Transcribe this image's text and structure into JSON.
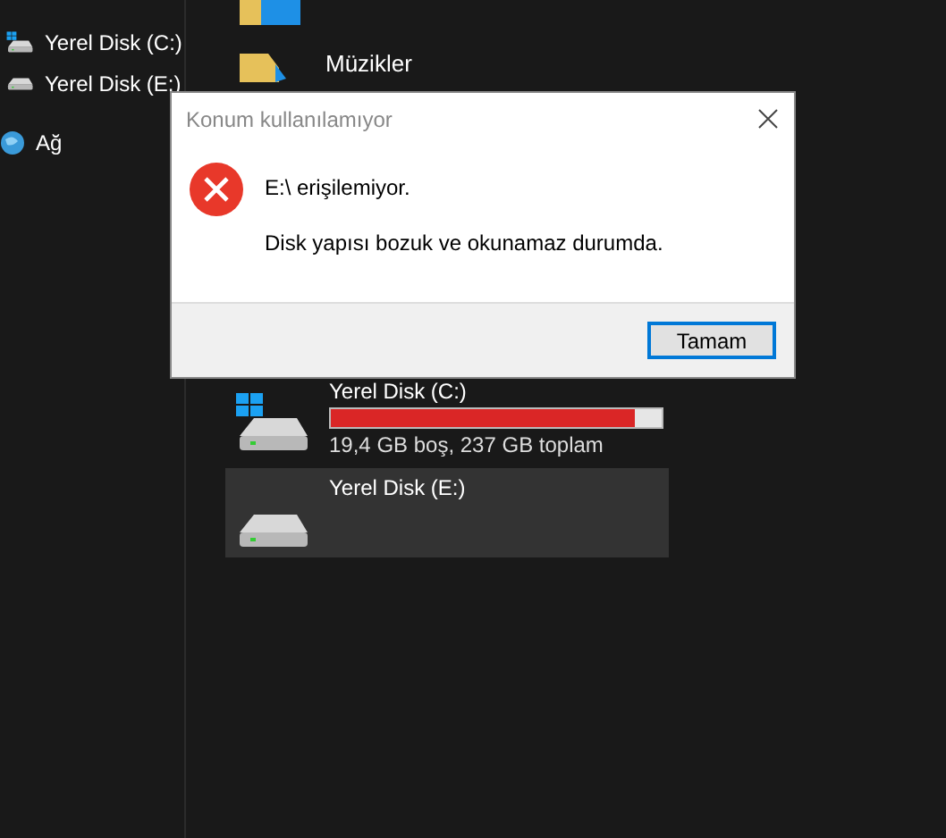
{
  "sidebar": {
    "items": [
      {
        "label": "Yerel Disk (C:)",
        "kind": "drive"
      },
      {
        "label": "Yerel Disk (E:)",
        "kind": "drive"
      },
      {
        "label": "Ağ",
        "kind": "network"
      }
    ]
  },
  "folders": [
    {
      "label": "Müzikler"
    }
  ],
  "drives": [
    {
      "name": "Yerel Disk (C:)",
      "system": true,
      "level": 0.92,
      "info": "19,4 GB boş, 237 GB toplam",
      "selected": false
    },
    {
      "name": "Yerel Disk (E:)",
      "system": false,
      "selected": true
    }
  ],
  "dialog": {
    "title": "Konum kullanılamıyor",
    "heading": "E:\\ erişilemiyor.",
    "message": "Disk yapısı bozuk ve okunamaz durumda.",
    "buttons": [
      "Tamam"
    ]
  }
}
